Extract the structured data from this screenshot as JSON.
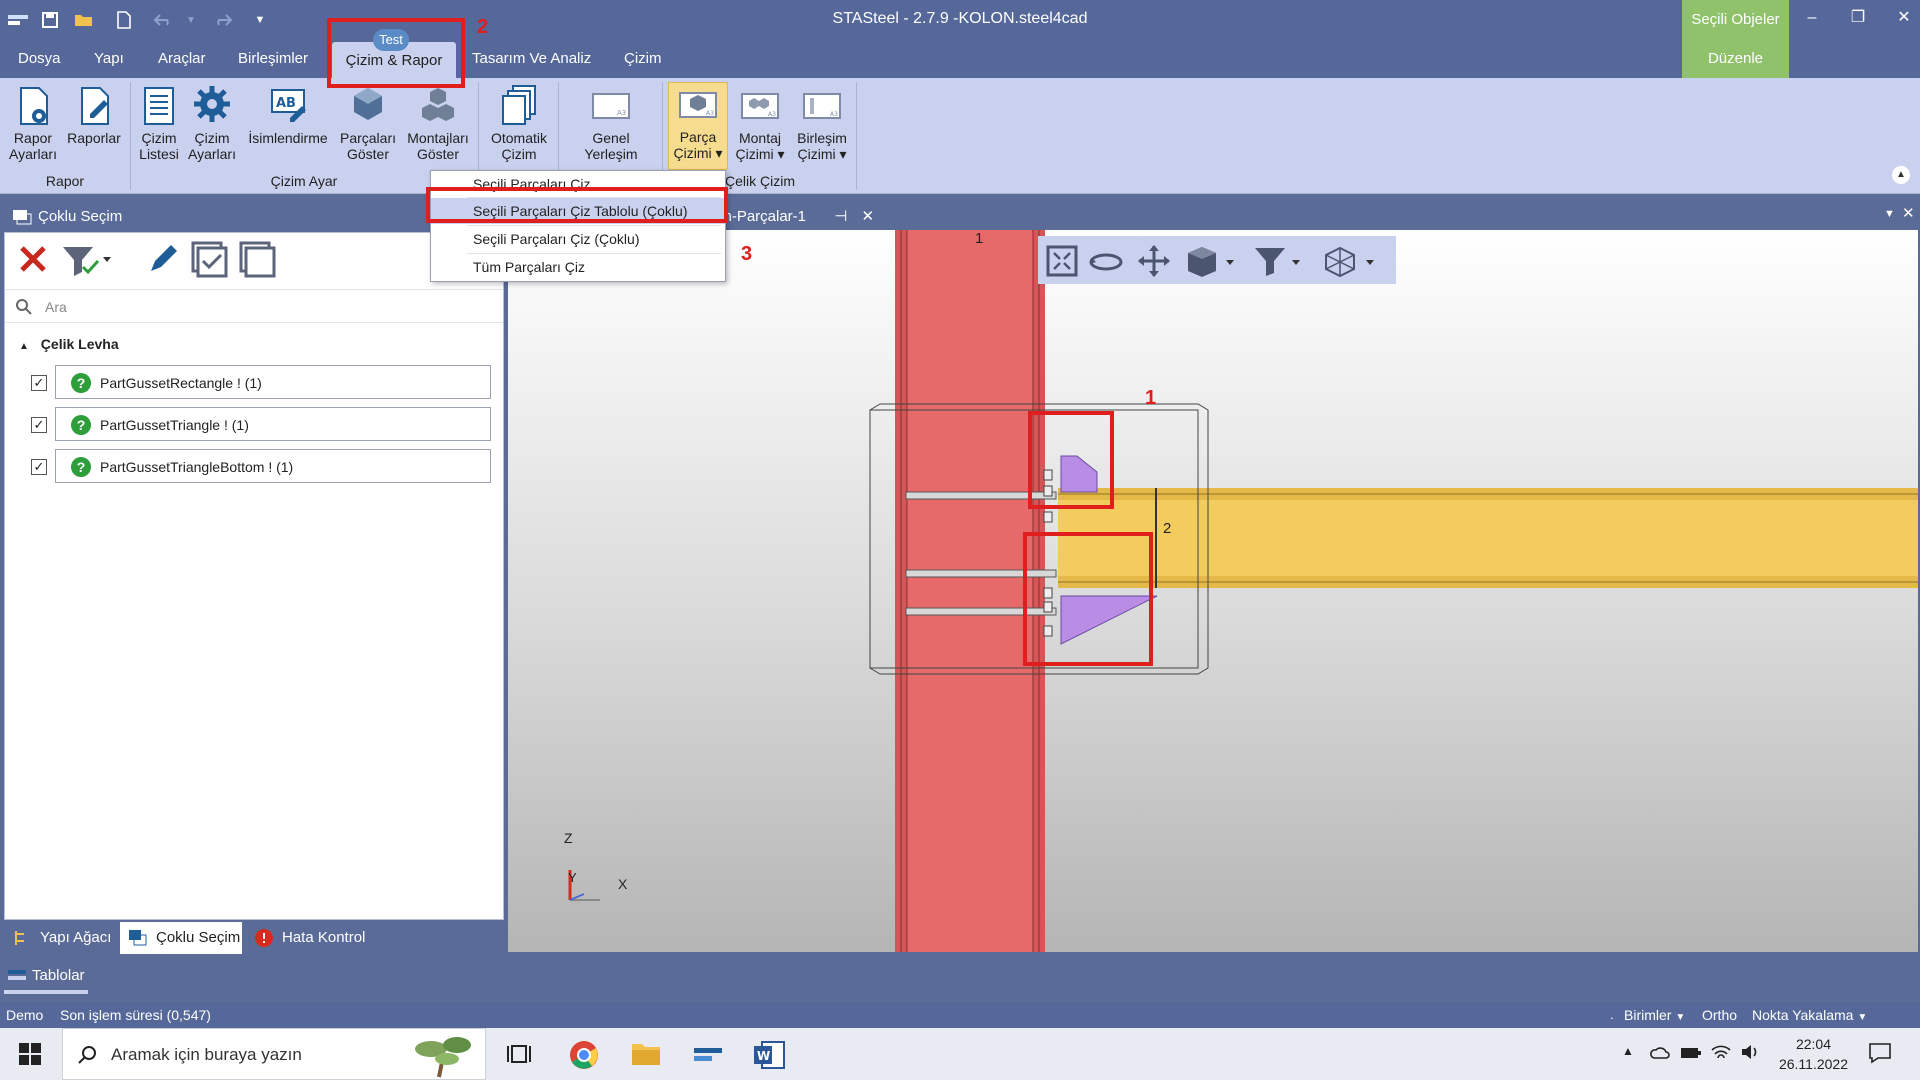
{
  "window": {
    "title": "STASteel - 2.7.9 -KOLON.steel4cad",
    "context_group": "Seçili Objeler",
    "minimize": "–",
    "maximize": "❐",
    "close": "✕"
  },
  "quick_access": {
    "save_icon": "save-icon",
    "open_icon": "folder-open-icon",
    "new_icon": "new-file-icon",
    "undo_icon": "undo-icon",
    "redo_icon": "redo-icon"
  },
  "menu": {
    "tabs": [
      "Dosya",
      "Yapı",
      "Araçlar",
      "Birleşimler",
      "Çizim & Rapor",
      "Tasarım Ve Analiz",
      "Çizim"
    ],
    "active_tab": "Çizim & Rapor",
    "badge": "Test",
    "context_tab": "Düzenle"
  },
  "ribbon": {
    "buttons": [
      {
        "line1": "Rapor",
        "line2": "Ayarları"
      },
      {
        "line1": "Raporlar",
        "line2": ""
      },
      {
        "line1": "Çizim",
        "line2": "Listesi"
      },
      {
        "line1": "Çizim",
        "line2": "Ayarları"
      },
      {
        "line1": "İsimlendirme",
        "line2": ""
      },
      {
        "line1": "Parçaları",
        "line2": "Göster"
      },
      {
        "line1": "Montajları",
        "line2": "Göster"
      },
      {
        "line1": "Otomatik",
        "line2": "Çizim"
      },
      {
        "line1": "Genel",
        "line2": "Yerleşim"
      },
      {
        "line1": "Parça",
        "line2": "Çizimi ▾"
      },
      {
        "line1": "Montaj",
        "line2": "Çizimi ▾"
      },
      {
        "line1": "Birleşim",
        "line2": "Çizimi ▾"
      }
    ],
    "groups": [
      "Rapor",
      "Çizim Ayar",
      "Çelik Çizim"
    ]
  },
  "dropdown": {
    "items": [
      "Seçili Parçaları Çiz",
      "Seçili Parçaları Çiz Tablolu (Çoklu)",
      "Seçili Parçaları Çiz (Çoklu)",
      "Tüm Parçaları Çiz"
    ],
    "highlighted_index": 1
  },
  "left_panel": {
    "title": "Çoklu Seçim",
    "search_placeholder": "Ara",
    "group": "Çelik Levha",
    "items": [
      {
        "label": "PartGussetRectangle ! (1)",
        "checked": true
      },
      {
        "label": "PartGussetTriangle ! (1)",
        "checked": true
      },
      {
        "label": "PartGussetTriangleBottom ! (1)",
        "checked": true
      }
    ],
    "check_mark": "✓",
    "item_icon_text": "?"
  },
  "bottom_tabs": [
    "Yapı Ağacı",
    "Çoklu Seçim",
    "Hata Kontrol"
  ],
  "tablolar": "Tablolar",
  "document_tab": {
    "title": "im-Parçalar-1",
    "pin": "⊣",
    "close": "✕"
  },
  "viewport": {
    "labels": {
      "column": "1",
      "beam": "2"
    },
    "axes": {
      "z": "Z",
      "y": "Y",
      "x": "X"
    }
  },
  "annotations": [
    "1",
    "2",
    "3"
  ],
  "status": {
    "left1": "Demo",
    "left2": "Son işlem süresi (0,547)",
    "birimler": "Birimler",
    "ortho": "Ortho",
    "nokta": "Nokta Yakalama"
  },
  "taskbar": {
    "search_placeholder": "Aramak için buraya yazın",
    "time": "22:04",
    "date": "26.11.2022"
  },
  "colors": {
    "chrome": "#56689a",
    "ribbon": "#c9d1ee",
    "context_green": "#8fc26b",
    "annotation_red": "#e01e1e",
    "column_red": "#e66a6a",
    "beam_yellow": "#f2cc5c",
    "gusset_purple": "#b98ce6"
  }
}
